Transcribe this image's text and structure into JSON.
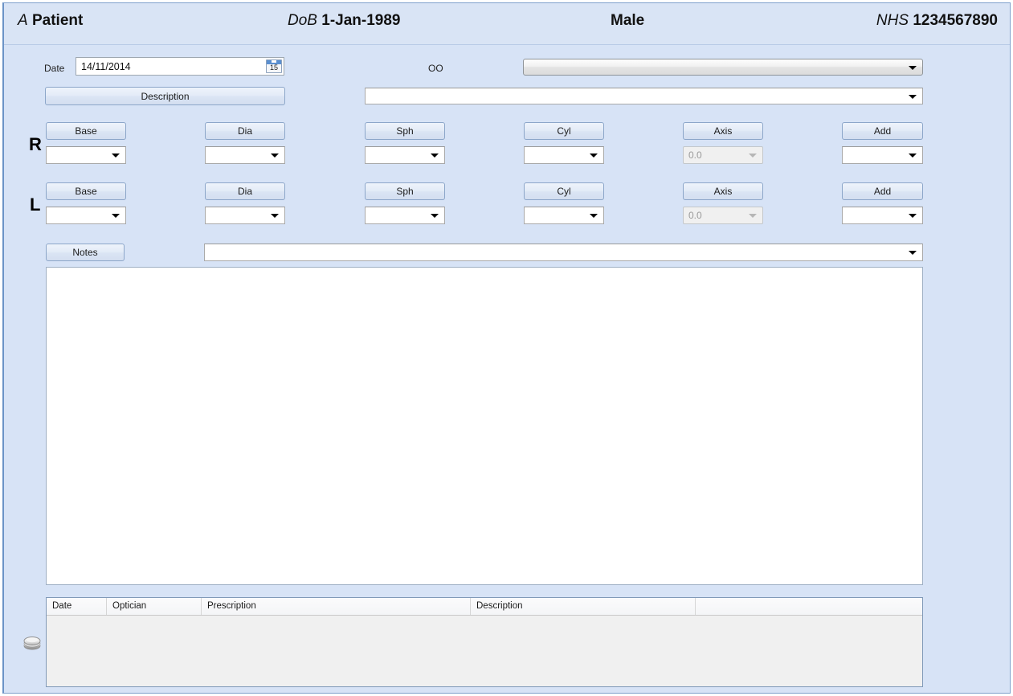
{
  "header": {
    "name_prefix": "A",
    "name": "Patient",
    "dob_label": "DoB",
    "dob_value": "1-Jan-1989",
    "gender": "Male",
    "nhs_label": "NHS",
    "nhs_value": "1234567890"
  },
  "form": {
    "date_label": "Date",
    "date_value": "14/11/2014",
    "calendar_icon_day": "15",
    "oo_label": "OO",
    "optician_combo_value": "",
    "description_button": "Description",
    "description_combo_value": "",
    "notes_button": "Notes",
    "notes_combo_value": "",
    "notes_pane_value": ""
  },
  "eyes": [
    {
      "side": "R",
      "fields": [
        {
          "label": "Base",
          "value": "",
          "disabled": false
        },
        {
          "label": "Dia",
          "value": "",
          "disabled": false
        },
        {
          "label": "Sph",
          "value": "",
          "disabled": false
        },
        {
          "label": "Cyl",
          "value": "",
          "disabled": false
        },
        {
          "label": "Axis",
          "value": "0.0",
          "disabled": true
        },
        {
          "label": "Add",
          "value": "",
          "disabled": false
        }
      ]
    },
    {
      "side": "L",
      "fields": [
        {
          "label": "Base",
          "value": "",
          "disabled": false
        },
        {
          "label": "Dia",
          "value": "",
          "disabled": false
        },
        {
          "label": "Sph",
          "value": "",
          "disabled": false
        },
        {
          "label": "Cyl",
          "value": "",
          "disabled": false
        },
        {
          "label": "Axis",
          "value": "0.0",
          "disabled": true
        },
        {
          "label": "Add",
          "value": "",
          "disabled": false
        }
      ]
    }
  ],
  "history_grid": {
    "columns": [
      {
        "label": "Date"
      },
      {
        "label": "Optician"
      },
      {
        "label": "Prescription"
      },
      {
        "label": "Description"
      },
      {
        "label": ""
      }
    ],
    "rows": []
  },
  "icons": {
    "disc_stack": "disc-stack-icon"
  },
  "colors": {
    "window_background": "#d7e3f6",
    "header_background": "#d9e4f5",
    "window_border": "#7fa0cc",
    "button_border": "#8ca6c9",
    "grid_body": "#f0f0f0",
    "calendar_accent": "#5a8fd0"
  }
}
